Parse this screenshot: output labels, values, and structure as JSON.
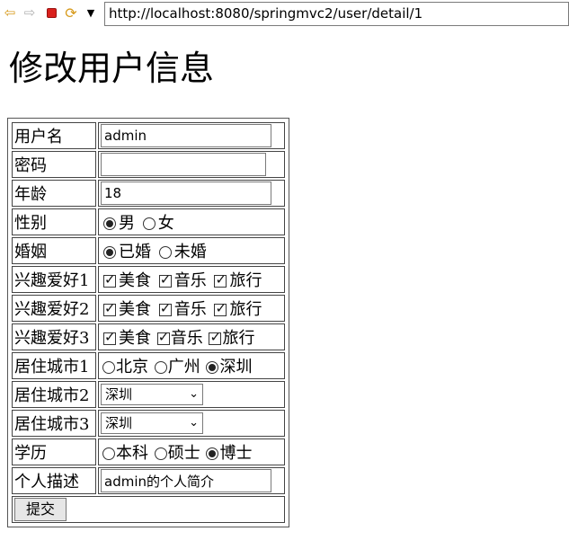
{
  "browser": {
    "url": "http://localhost:8080/springmvc2/user/detail/1"
  },
  "page": {
    "title": "修改用户信息"
  },
  "form": {
    "username": {
      "label": "用户名",
      "value": "admin"
    },
    "password": {
      "label": "密码",
      "value": ""
    },
    "age": {
      "label": "年龄",
      "value": "18"
    },
    "gender": {
      "label": "性别",
      "options": [
        "男",
        "女"
      ],
      "selected": "男"
    },
    "marriage": {
      "label": "婚姻",
      "options": [
        "已婚",
        "未婚"
      ],
      "selected": "已婚"
    },
    "hobby1": {
      "label": "兴趣爱好1",
      "options": [
        "美食",
        "音乐",
        "旅行"
      ],
      "checked": [
        true,
        true,
        true
      ]
    },
    "hobby2": {
      "label": "兴趣爱好2",
      "options": [
        "美食",
        "音乐",
        "旅行"
      ],
      "checked": [
        true,
        true,
        true
      ]
    },
    "hobby3": {
      "label": "兴趣爱好3",
      "options": [
        "美食",
        "音乐",
        "旅行"
      ],
      "checked": [
        true,
        true,
        true
      ]
    },
    "city1": {
      "label": "居住城市1",
      "options": [
        "北京",
        "广州",
        "深圳"
      ],
      "selected": "深圳"
    },
    "city2": {
      "label": "居住城市2",
      "selected": "深圳"
    },
    "city3": {
      "label": "居住城市3",
      "selected": "深圳"
    },
    "education": {
      "label": "学历",
      "options": [
        "本科",
        "硕士",
        "博士"
      ],
      "selected": "博士"
    },
    "description": {
      "label": "个人描述",
      "value": "admin的个人简介"
    },
    "submit_label": "提交"
  }
}
